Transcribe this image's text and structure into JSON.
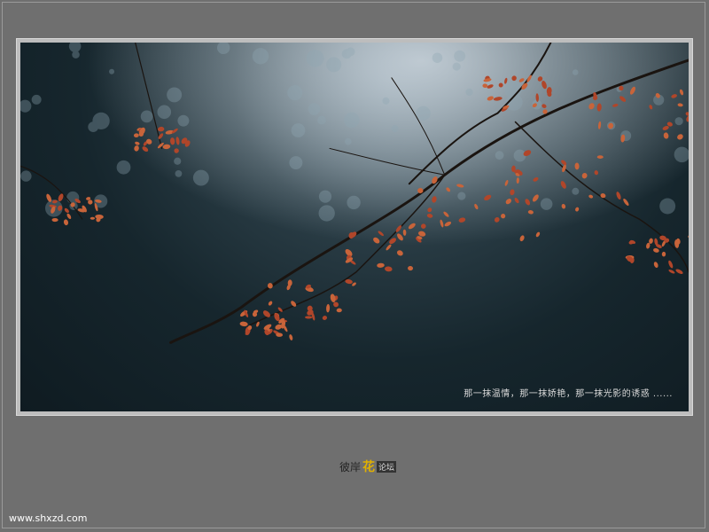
{
  "photo": {
    "caption": "那一抹温情，那一抹娇艳，那一抹光影的诱惑 ......",
    "subject": "autumn-branches-icon"
  },
  "logo": {
    "text_left": "彼岸",
    "mark": "花",
    "text_right": "论坛"
  },
  "footer": {
    "site_url": "www.shxzd.com"
  }
}
